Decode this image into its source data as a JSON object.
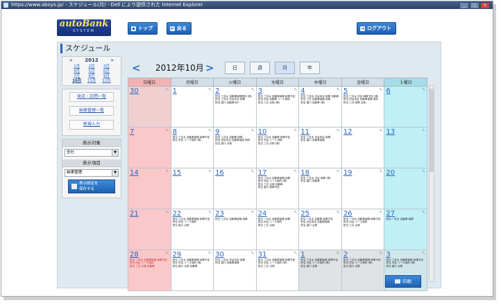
{
  "window": {
    "title": "https://www.aboys.jp/ - スケジュール(月) - Dell により提供された Internet Explorer",
    "buttons": [
      "_",
      "□",
      "×"
    ]
  },
  "header": {
    "logo_main": "autoBank",
    "logo_sub": "SYSTEM",
    "top_label": "トップ",
    "back_label": "戻る",
    "logout_label": "ログアウト"
  },
  "page_title": "スケジュール",
  "sidebar": {
    "year": "2012",
    "prev": "«",
    "next": "»",
    "months": [
      "1月",
      "2月",
      "3月",
      "4月",
      "5月",
      "6月",
      "7月",
      "8月",
      "9月",
      "10月",
      "11月",
      "12月"
    ],
    "current_month": "10月",
    "nav": [
      "来店・訪問一覧",
      "納車管理一覧",
      "新規入力"
    ],
    "filter_target_label": "表示対象",
    "filter_target_value": "全社",
    "filter_item_label": "表示項目",
    "filter_item_value": "納車管理",
    "save_label_1": "表示設定を",
    "save_label_2": "保存する"
  },
  "calendar": {
    "prev": "<",
    "next": ">",
    "month_title": "2012年10月",
    "views": [
      "日",
      "週",
      "月",
      "年"
    ],
    "active_view": "月",
    "weekdays": [
      "日曜日",
      "月曜日",
      "火曜日",
      "水曜日",
      "木曜日",
      "金曜日",
      "土曜日"
    ],
    "weeks": [
      [
        {
          "day": "30",
          "off": true,
          "events": []
        },
        {
          "day": "1",
          "events": []
        },
        {
          "day": "2",
          "events": [
            "担当 三井太 自動車保険契約 (株)",
            "担当 三井太 渋谷本店 納車",
            "担当 高口 自動車ほか"
          ]
        },
        {
          "day": "3",
          "events": [
            "担当 三井太 自動車保険 納車予定",
            "担当 渋谷 自動車 リース契約",
            "担当 三井 点検 (株)"
          ]
        },
        {
          "day": "4",
          "events": [
            "担当 三井太 渋谷本店 納車 自動車",
            "担当 三井 自動車保険 納車",
            "担当 高口 自動車 (株)"
          ]
        },
        {
          "day": "5",
          "events": [
            "担当 三井太 渋谷 納車予定 (株)",
            "担当 渋谷本店 自動車保険 契約",
            "担当 三井 納車 点検"
          ]
        },
        {
          "day": "6",
          "events": []
        }
      ],
      [
        {
          "day": "7",
          "events": []
        },
        {
          "day": "8",
          "events": [
            "担当 三井太 自動車保険 納車予定",
            "担当 渋谷 リース契約 (株)"
          ]
        },
        {
          "day": "9",
          "events": [
            "担当 三井太 自動車 納車",
            "担当 渋谷本店 自動車保険 契約",
            "担当 高口 点検"
          ]
        },
        {
          "day": "10",
          "events": [
            "担当 三井太 自動車 納車予定",
            "担当 渋谷 リース 契約",
            "担当 三井 点検 (株)"
          ]
        },
        {
          "day": "11",
          "events": [
            "担当 三井太 渋谷本店 納車",
            "担当 高口 自動車保険"
          ]
        },
        {
          "day": "12",
          "events": []
        },
        {
          "day": "13",
          "events": []
        }
      ],
      [
        {
          "day": "14",
          "events": []
        },
        {
          "day": "15",
          "events": []
        },
        {
          "day": "16",
          "events": []
        },
        {
          "day": "17",
          "events": [
            "担当 三井太 自動車保険 納車",
            "担当 渋谷 リース契約 (株)",
            "担当 三井 点検 自動車",
            "担当 高口 納車予定"
          ]
        },
        {
          "day": "18",
          "events": [
            "担当 三井太 渋谷 納車 (株)",
            "担当 高口 自動車"
          ]
        },
        {
          "day": "19",
          "events": []
        },
        {
          "day": "20",
          "events": []
        }
      ],
      [
        {
          "day": "21",
          "events": []
        },
        {
          "day": "22",
          "events": [
            "担当 三井太 自動車保険 納車予定",
            "担当 渋谷 リース契約",
            "担当 高口 点検"
          ]
        },
        {
          "day": "23",
          "events": [
            "担当 三井太 自動車保険 納車"
          ]
        },
        {
          "day": "24",
          "events": [
            "担当 一井太 自動車保険 納車",
            "担当 渋谷 リース契約",
            "担当 三井 点検"
          ]
        },
        {
          "day": "25",
          "events": [
            "担当 一井太 自動車 納車予定",
            "担当 渋谷本店 自動車保険",
            "担当 高口 点検"
          ]
        },
        {
          "day": "26",
          "events": [
            "担当 一井太 自動車保険 納車予定",
            "担当 渋谷 リース契約",
            "担当 三井 点検"
          ]
        },
        {
          "day": "27",
          "events": [
            "担当 一井太 自動車 納車"
          ]
        }
      ],
      [
        {
          "day": "28",
          "events": [
            "担当 一井太 自動車保険 納車予定",
            "担当 渋谷 リース契約",
            "担当 三井 点検 自動車"
          ],
          "red": true
        },
        {
          "day": "29",
          "events": [
            "担当 三井太 自動車保険 納車予定",
            "担当 渋谷 リース契約 (株)",
            "担当 高口 点検 自動車"
          ]
        },
        {
          "day": "30",
          "events": [
            "担当 三井太 渋谷本店 納車",
            "担当 高口 自動車保険"
          ]
        },
        {
          "day": "31",
          "events": [
            "担当 三井太 自動車保険 納車予定",
            "担当 渋谷 リース契約 (株)",
            "担当 三井 点検"
          ]
        },
        {
          "day": "1",
          "off": true,
          "events": [
            "担当 三井太 自動車保険 納車予定",
            "担当 渋谷 リース契約 (株)",
            "担当 高口 点検"
          ]
        },
        {
          "day": "2",
          "off": true,
          "events": [
            "担当 三井太 自動車保険 納車予定",
            "担当 渋谷 リース契約 (株)",
            "担当 高口 点検"
          ]
        },
        {
          "day": "3",
          "off": true,
          "events": [
            "担当 三井太 自動車保険 納車予定",
            "担当 渋谷 リース契約 (株)",
            "担当 高口 点検"
          ]
        }
      ]
    ],
    "print_label": "印刷"
  }
}
